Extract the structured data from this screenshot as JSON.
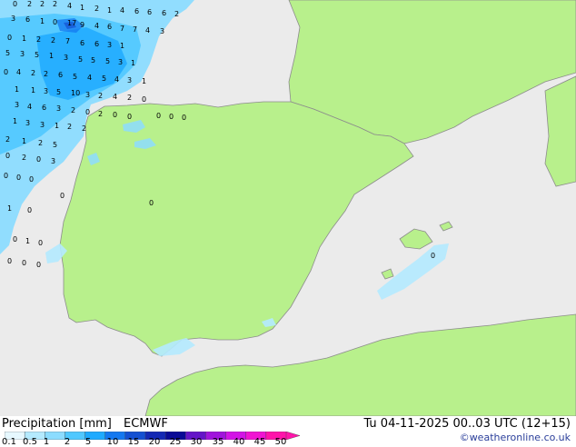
{
  "map": {
    "land_color": "#b8f08c",
    "sea_color": "#ebebeb",
    "coast_color": "#8c8c8c",
    "precip_labels": [
      "0",
      "2",
      "2",
      "2",
      "4",
      "1",
      "2",
      "1",
      "4",
      "6",
      "6",
      "6",
      "2",
      "3",
      "6",
      "1",
      "0",
      "17",
      "9",
      "4",
      "6",
      "7",
      "7",
      "4",
      "3",
      "0",
      "1",
      "2",
      "2",
      "7",
      "6",
      "6",
      "3",
      "1",
      "5",
      "3",
      "5",
      "1",
      "3",
      "5",
      "5",
      "5",
      "3",
      "1",
      "0",
      "4",
      "2",
      "2",
      "6",
      "5",
      "4",
      "5",
      "4",
      "3",
      "1",
      "1",
      "1",
      "3",
      "5",
      "10",
      "3",
      "2",
      "4",
      "2",
      "0",
      "3",
      "4",
      "6",
      "3",
      "2",
      "0",
      "2",
      "0",
      "0",
      "1",
      "3",
      "3",
      "1",
      "2",
      "2",
      "2",
      "1",
      "2",
      "5",
      "0",
      "2",
      "0",
      "3",
      "0",
      "0",
      "0",
      "0",
      "1",
      "0",
      "0",
      "1",
      "0",
      "0",
      "0",
      "0",
      "0",
      "0",
      "0",
      "0",
      "0"
    ]
  },
  "footer": {
    "legend_title": "Precipitation [mm]",
    "model": "ECMWF",
    "valid_time": "Tu 04-11-2025 00..03 UTC (12+15)",
    "credit": "©weatheronline.co.uk",
    "legend_ticks": [
      "0.1",
      "0.5",
      "1",
      "2",
      "5",
      "10",
      "15",
      "20",
      "25",
      "30",
      "35",
      "40",
      "45",
      "50"
    ],
    "legend_colors": [
      "#e6f8ff",
      "#b4eaff",
      "#8cdcff",
      "#50c8ff",
      "#1eaaff",
      "#1478f0",
      "#1450d2",
      "#1428b4",
      "#0a0a96",
      "#6414c8",
      "#a014dc",
      "#d214e6",
      "#f014d2",
      "#ff14aa"
    ]
  }
}
